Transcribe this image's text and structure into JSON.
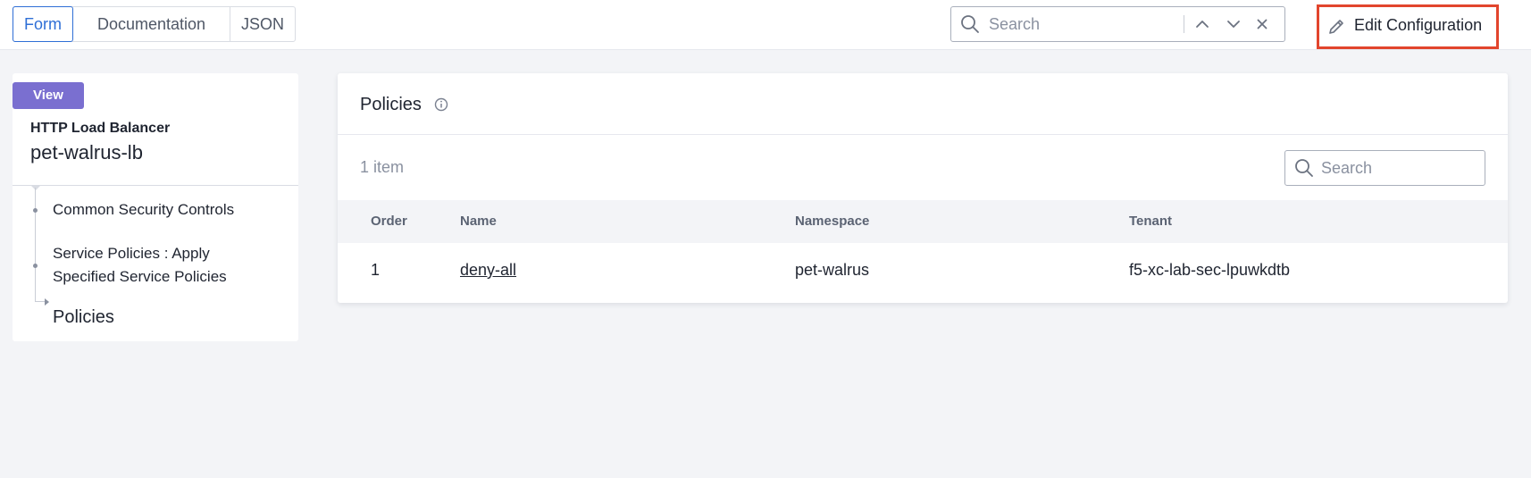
{
  "tabs": [
    {
      "label": "Form",
      "active": true
    },
    {
      "label": "Documentation",
      "active": false
    },
    {
      "label": "JSON",
      "active": false
    }
  ],
  "top_search": {
    "placeholder": "Search",
    "value": ""
  },
  "edit_button": {
    "label": "Edit Configuration",
    "highlight_color": "#e2452d"
  },
  "left_panel": {
    "badge": "View",
    "object_type": "HTTP Load Balancer",
    "object_name": "pet-walrus-lb",
    "tree": [
      {
        "label": "Common Security Controls"
      },
      {
        "label_line1": "Service Policies : Apply",
        "label_line2": "Specified Service Policies"
      },
      {
        "label": "Policies",
        "current": true
      }
    ]
  },
  "policies_panel": {
    "title": "Policies",
    "item_count": "1 item",
    "search_placeholder": "Search",
    "columns": [
      "Order",
      "Name",
      "Namespace",
      "Tenant"
    ],
    "rows": [
      {
        "order": "1",
        "name": "deny-all",
        "namespace": "pet-walrus",
        "tenant": "f5-xc-lab-sec-lpuwkdtb"
      }
    ]
  },
  "colors": {
    "accent": "#2f6fd6",
    "badge": "#7a6fd0",
    "page_bg": "#f3f4f7"
  }
}
